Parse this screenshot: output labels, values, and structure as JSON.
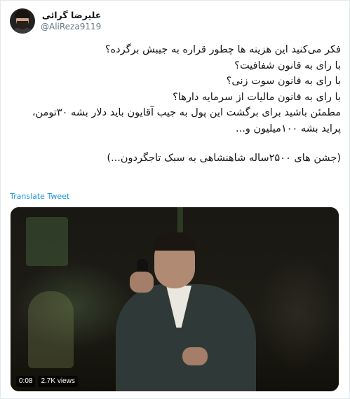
{
  "tweet": {
    "author": {
      "display_name": "علیرضا گرائی",
      "handle": "@AliReza9119"
    },
    "text_lines": [
      "فکر می‌کنید این هزینه ها چطور قراره به جیبش برگرده؟",
      "با رای به قانون شفافیت؟",
      "با رای به قانون سوت زنی؟",
      "با رای به قانون مالیات از سرمایه دارها؟",
      "مطمئن باشید برای برگشت این پول به جیب آقایون باید دلار بشه ۳۰تومن،",
      "پراید بشه ۱۰۰میلیون و..."
    ],
    "closing_line": "(جشن های ۲۵۰۰ساله شاهنشاهی به سبک تاجگردون...)",
    "translate_label": "Translate Tweet",
    "video": {
      "timestamp": "0:08",
      "views": "2.7K views"
    }
  }
}
